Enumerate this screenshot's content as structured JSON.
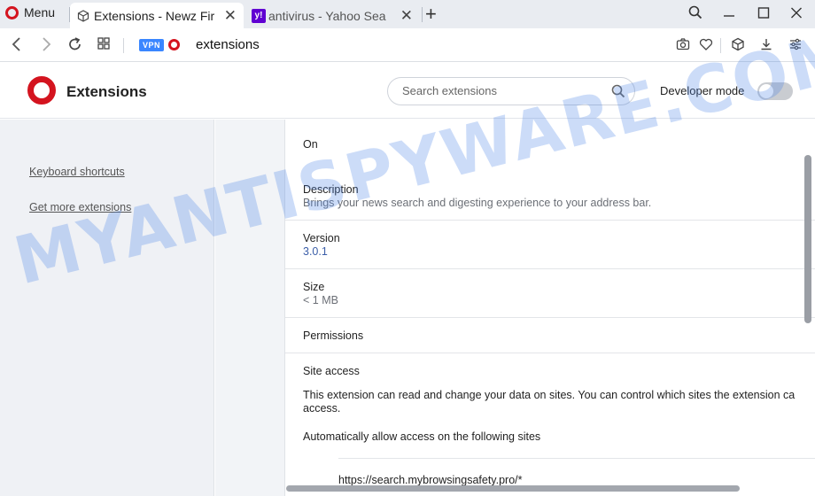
{
  "browser": {
    "menu_label": "Menu",
    "tabs": [
      {
        "title": "Extensions - Newz Fir",
        "icon": "cube-icon",
        "active": true
      },
      {
        "title": "antivirus - Yahoo Sea",
        "icon": "yahoo-icon",
        "active": false
      }
    ],
    "address": {
      "vpn_badge": "VPN",
      "url": "extensions"
    }
  },
  "header": {
    "title": "Extensions",
    "search_placeholder": "Search extensions",
    "developer_mode_label": "Developer mode",
    "developer_mode_on": false
  },
  "sidebar": {
    "links": [
      "Keyboard shortcuts",
      "Get more extensions"
    ]
  },
  "details": {
    "status": "On",
    "description_label": "Description",
    "description": "Brings your news search and digesting experience to your address bar.",
    "version_label": "Version",
    "version": "3.0.1",
    "size_label": "Size",
    "size": "< 1 MB",
    "permissions_label": "Permissions",
    "site_access_label": "Site access",
    "site_access_text_1": "This extension can read and change your data on sites. You can control which sites the extension ca",
    "site_access_text_2": "access.",
    "auto_allow_label": "Automatically allow access on the following sites",
    "site": "https://search.mybrowsingsafety.pro/*"
  },
  "watermark": "MYANTISPYWARE.COM",
  "colors": {
    "opera_red": "#d4141f",
    "accent_blue": "#3a86ff",
    "yahoo_purple": "#6001d2"
  }
}
